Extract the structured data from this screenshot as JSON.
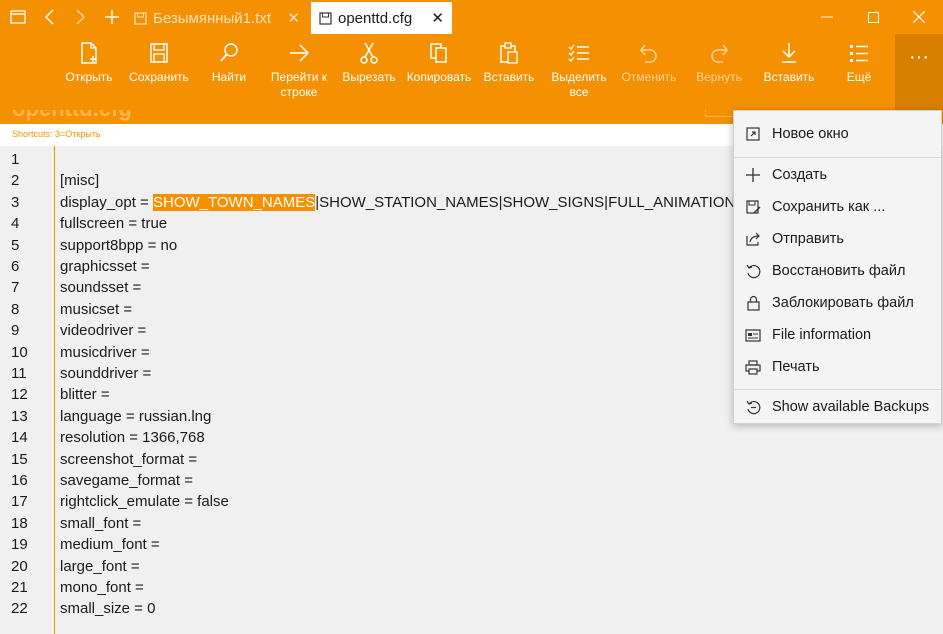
{
  "tabs": [
    {
      "label": "Безымянный1.txt",
      "active": false
    },
    {
      "label": "openttd.cfg",
      "active": true
    }
  ],
  "toolbar": {
    "open": "Открыть",
    "save": "Сохранить",
    "find": "Найти",
    "goto_line": [
      "Перейти к",
      "строке"
    ],
    "cut": "Вырезать",
    "copy": "Копировать",
    "paste": "Вставить",
    "select_all": [
      "Выделить",
      "все"
    ],
    "undo": "Отменить",
    "redo": "Вернуть",
    "insert": "Вставить",
    "more": "Ещё",
    "more_glyph": "···"
  },
  "doc_title_ghost": "openttd.cfg",
  "shortcuts": "Shortcuts:  3=Открыть",
  "editor": {
    "line_numbers": [
      "1",
      "2",
      "3",
      "4",
      "5",
      "6",
      "7",
      "8",
      "9",
      "10",
      "11",
      "12",
      "13",
      "14",
      "15",
      "16",
      "17",
      "18",
      "19",
      "20",
      "21",
      "22"
    ],
    "lines": [
      "",
      "[misc]",
      "display_opt = ",
      "fullscreen = true",
      "support8bpp = no",
      "graphicsset =",
      "soundsset =",
      "musicset =",
      "videodriver =",
      "musicdriver =",
      "sounddriver =",
      "blitter =",
      "language = russian.lng",
      "resolution = 1366,768",
      "screenshot_format =",
      "savegame_format =",
      "rightclick_emulate = false",
      "small_font =",
      "medium_font =",
      "large_font =",
      "mono_font =",
      "small_size = 0"
    ],
    "selected_text": "SHOW_TOWN_NAMES",
    "line3_rest": "|SHOW_STATION_NAMES|SHOW_SIGNS|FULL_ANIMATION|"
  },
  "menu": {
    "new_window": "Новое окно",
    "create": "Создать",
    "save_as": "Сохранить как ...",
    "send": "Отправить",
    "restore": "Восстановить файл",
    "lock": "Заблокировать файл",
    "file_info": "File information",
    "print": "Печать",
    "backups": "Show available Backups"
  },
  "colors": {
    "accent": "#f59100",
    "menu_bg": "#f4f4f4",
    "editor_bg": "#f0f0f0"
  }
}
